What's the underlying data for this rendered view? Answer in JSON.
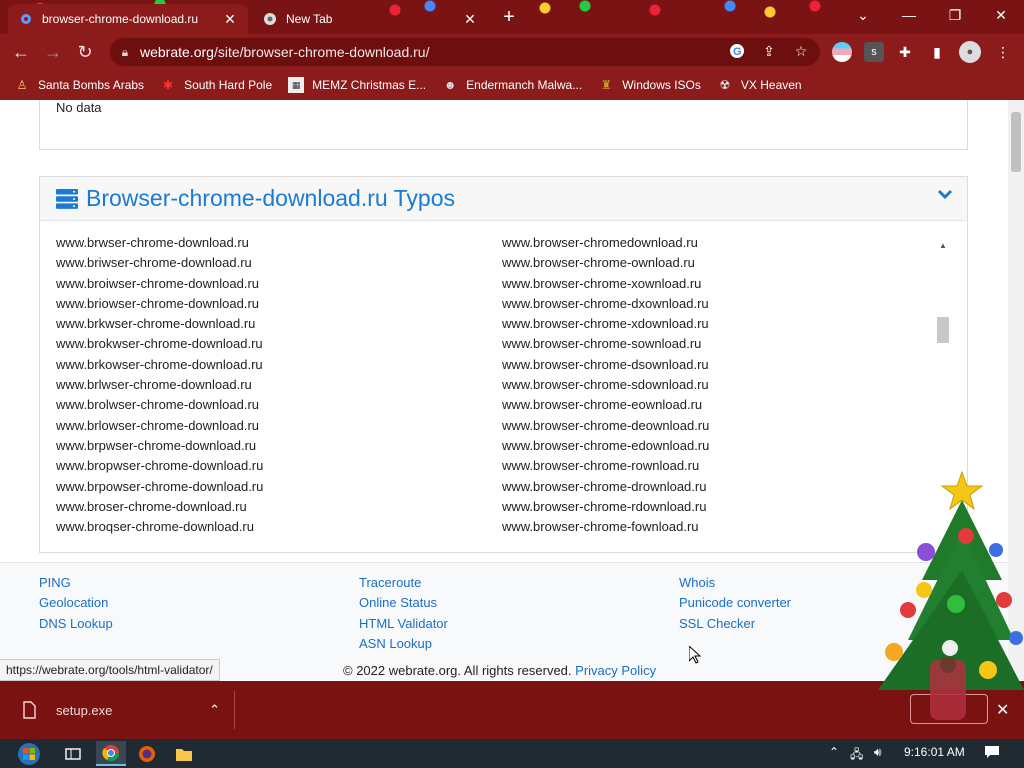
{
  "tabs": [
    {
      "title": "browser-chrome-download.ru",
      "active": true
    },
    {
      "title": "New Tab",
      "active": false
    }
  ],
  "omnibox": {
    "host": "webrate.org",
    "path": "/site/browser-chrome-download.ru/"
  },
  "bookmarks": [
    {
      "label": "Santa Bombs Arabs",
      "icon": "santa-icon"
    },
    {
      "label": "South Hard Pole",
      "icon": "snowflake-icon"
    },
    {
      "label": "MEMZ Christmas E...",
      "icon": "memz-icon"
    },
    {
      "label": "Endermanch Malwa...",
      "icon": "endermanch-icon"
    },
    {
      "label": "Windows ISOs",
      "icon": "windows-iso-icon"
    },
    {
      "label": "VX Heaven",
      "icon": "vx-heaven-icon"
    }
  ],
  "page": {
    "previous_card_text": "No data",
    "typos_title": "Browser-chrome-download.ru Typos",
    "typos_left": [
      "www.brwser-chrome-download.ru",
      "www.briwser-chrome-download.ru",
      "www.broiwser-chrome-download.ru",
      "www.briowser-chrome-download.ru",
      "www.brkwser-chrome-download.ru",
      "www.brokwser-chrome-download.ru",
      "www.brkowser-chrome-download.ru",
      "www.brlwser-chrome-download.ru",
      "www.brolwser-chrome-download.ru",
      "www.brlowser-chrome-download.ru",
      "www.brpwser-chrome-download.ru",
      "www.bropwser-chrome-download.ru",
      "www.brpowser-chrome-download.ru",
      "www.broser-chrome-download.ru",
      "www.broqser-chrome-download.ru"
    ],
    "typos_right": [
      "www.browser-chromedownload.ru",
      "www.browser-chrome-ownload.ru",
      "www.browser-chrome-xownload.ru",
      "www.browser-chrome-dxownload.ru",
      "www.browser-chrome-xdownload.ru",
      "www.browser-chrome-sownload.ru",
      "www.browser-chrome-dsownload.ru",
      "www.browser-chrome-sdownload.ru",
      "www.browser-chrome-eownload.ru",
      "www.browser-chrome-deownload.ru",
      "www.browser-chrome-edownload.ru",
      "www.browser-chrome-rownload.ru",
      "www.browser-chrome-drownload.ru",
      "www.browser-chrome-rdownload.ru",
      "www.browser-chrome-fownload.ru"
    ]
  },
  "footer": {
    "col1": [
      "PING",
      "Geolocation",
      "DNS Lookup"
    ],
    "col2": [
      "Traceroute",
      "Online Status",
      "HTML Validator",
      "ASN Lookup"
    ],
    "col3": [
      "Whois",
      "Punicode converter",
      "SSL Checker"
    ],
    "copyright": "© 2022 webrate.org. All rights reserved.",
    "privacy": "Privacy Policy"
  },
  "status_url": "https://webrate.org/tools/html-validator/",
  "download": {
    "filename": "setup.exe"
  },
  "taskbar": {
    "time": "9:16:01 AM"
  },
  "colors": {
    "chrome_red": "#8c1b1b",
    "link_blue": "#1a7ad4",
    "taskbar": "#1f2a33"
  }
}
